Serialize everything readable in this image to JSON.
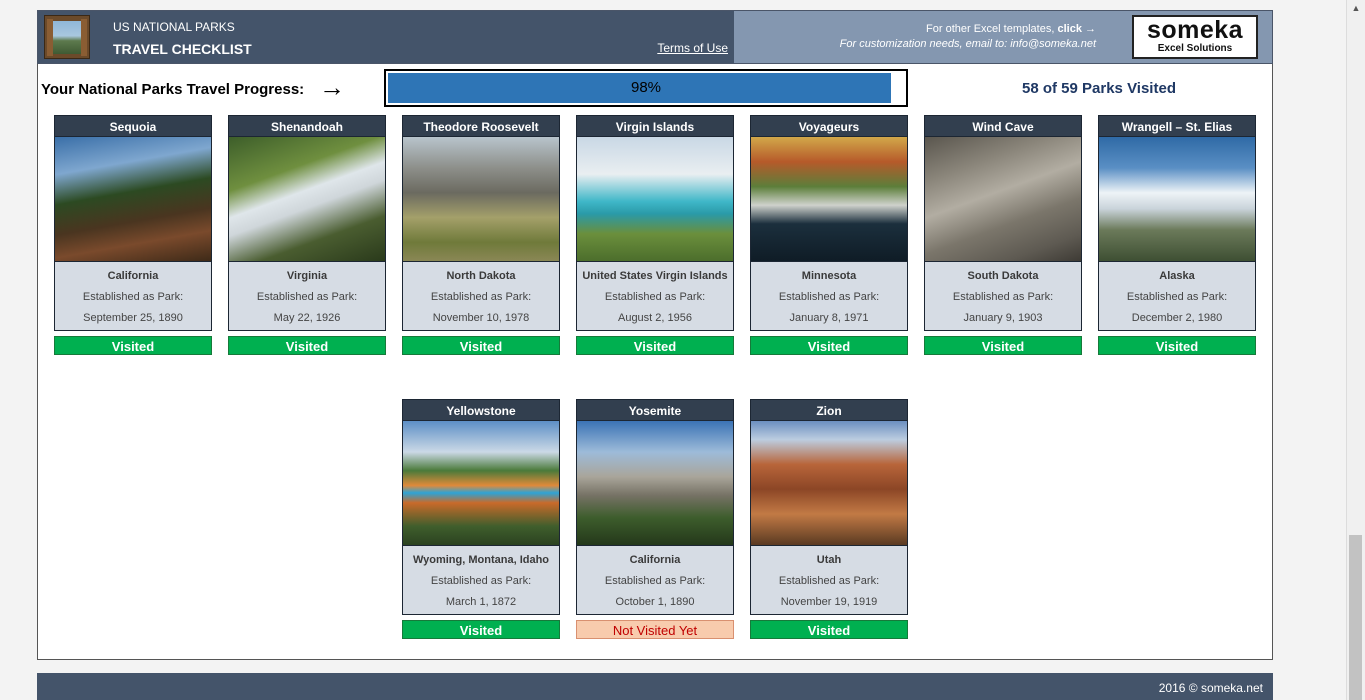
{
  "header": {
    "title_small": "US NATIONAL PARKS",
    "title_large": "TRAVEL CHECKLIST",
    "terms_link": "Terms of Use",
    "templates_text": "For other Excel templates, ",
    "templates_click": "click →",
    "custom_text": "For customization needs, email to: info@someka.net",
    "logo_word": "someka",
    "logo_sub": "Excel Solutions"
  },
  "progress": {
    "label": "Your National Parks Travel Progress:",
    "arrow": "→",
    "percent_text": "98%",
    "fraction": 0.98,
    "count_text": "58 of 59 Parks Visited"
  },
  "colors": {
    "header_dark": "#44546a",
    "header_light": "#8497b0",
    "bar_fill": "#2e75b6",
    "visited_green": "#00b050",
    "not_visited_bg": "#f8cbad",
    "not_visited_text": "#c00000"
  },
  "parks": [
    {
      "name": "Sequoia",
      "state": "California",
      "est_label": "Established as Park:",
      "date": "September 25, 1890",
      "status": "Visited",
      "visited": true
    },
    {
      "name": "Shenandoah",
      "state": "Virginia",
      "est_label": "Established as Park:",
      "date": "May 22, 1926",
      "status": "Visited",
      "visited": true
    },
    {
      "name": "Theodore Roosevelt",
      "state": "North Dakota",
      "est_label": "Established as Park:",
      "date": "November 10, 1978",
      "status": "Visited",
      "visited": true
    },
    {
      "name": "Virgin Islands",
      "state": "United States Virgin Islands",
      "est_label": "Established as Park:",
      "date": "August 2, 1956",
      "status": "Visited",
      "visited": true
    },
    {
      "name": "Voyageurs",
      "state": "Minnesota",
      "est_label": "Established as Park:",
      "date": "January 8, 1971",
      "status": "Visited",
      "visited": true
    },
    {
      "name": "Wind Cave",
      "state": "South Dakota",
      "est_label": "Established as Park:",
      "date": "January 9, 1903",
      "status": "Visited",
      "visited": true
    },
    {
      "name": "Wrangell – St. Elias",
      "state": "Alaska",
      "est_label": "Established as Park:",
      "date": "December 2, 1980",
      "status": "Visited",
      "visited": true
    },
    {
      "name": "Yellowstone",
      "state": "Wyoming, Montana, Idaho",
      "est_label": "Established as Park:",
      "date": "March 1, 1872",
      "status": "Visited",
      "visited": true
    },
    {
      "name": "Yosemite",
      "state": "California",
      "est_label": "Established as Park:",
      "date": "October 1, 1890",
      "status": "Not Visited Yet",
      "visited": false
    },
    {
      "name": "Zion",
      "state": "Utah",
      "est_label": "Established as Park:",
      "date": "November 19, 1919",
      "status": "Visited",
      "visited": true
    }
  ],
  "footer": {
    "copyright": "2016 © someka.net"
  }
}
